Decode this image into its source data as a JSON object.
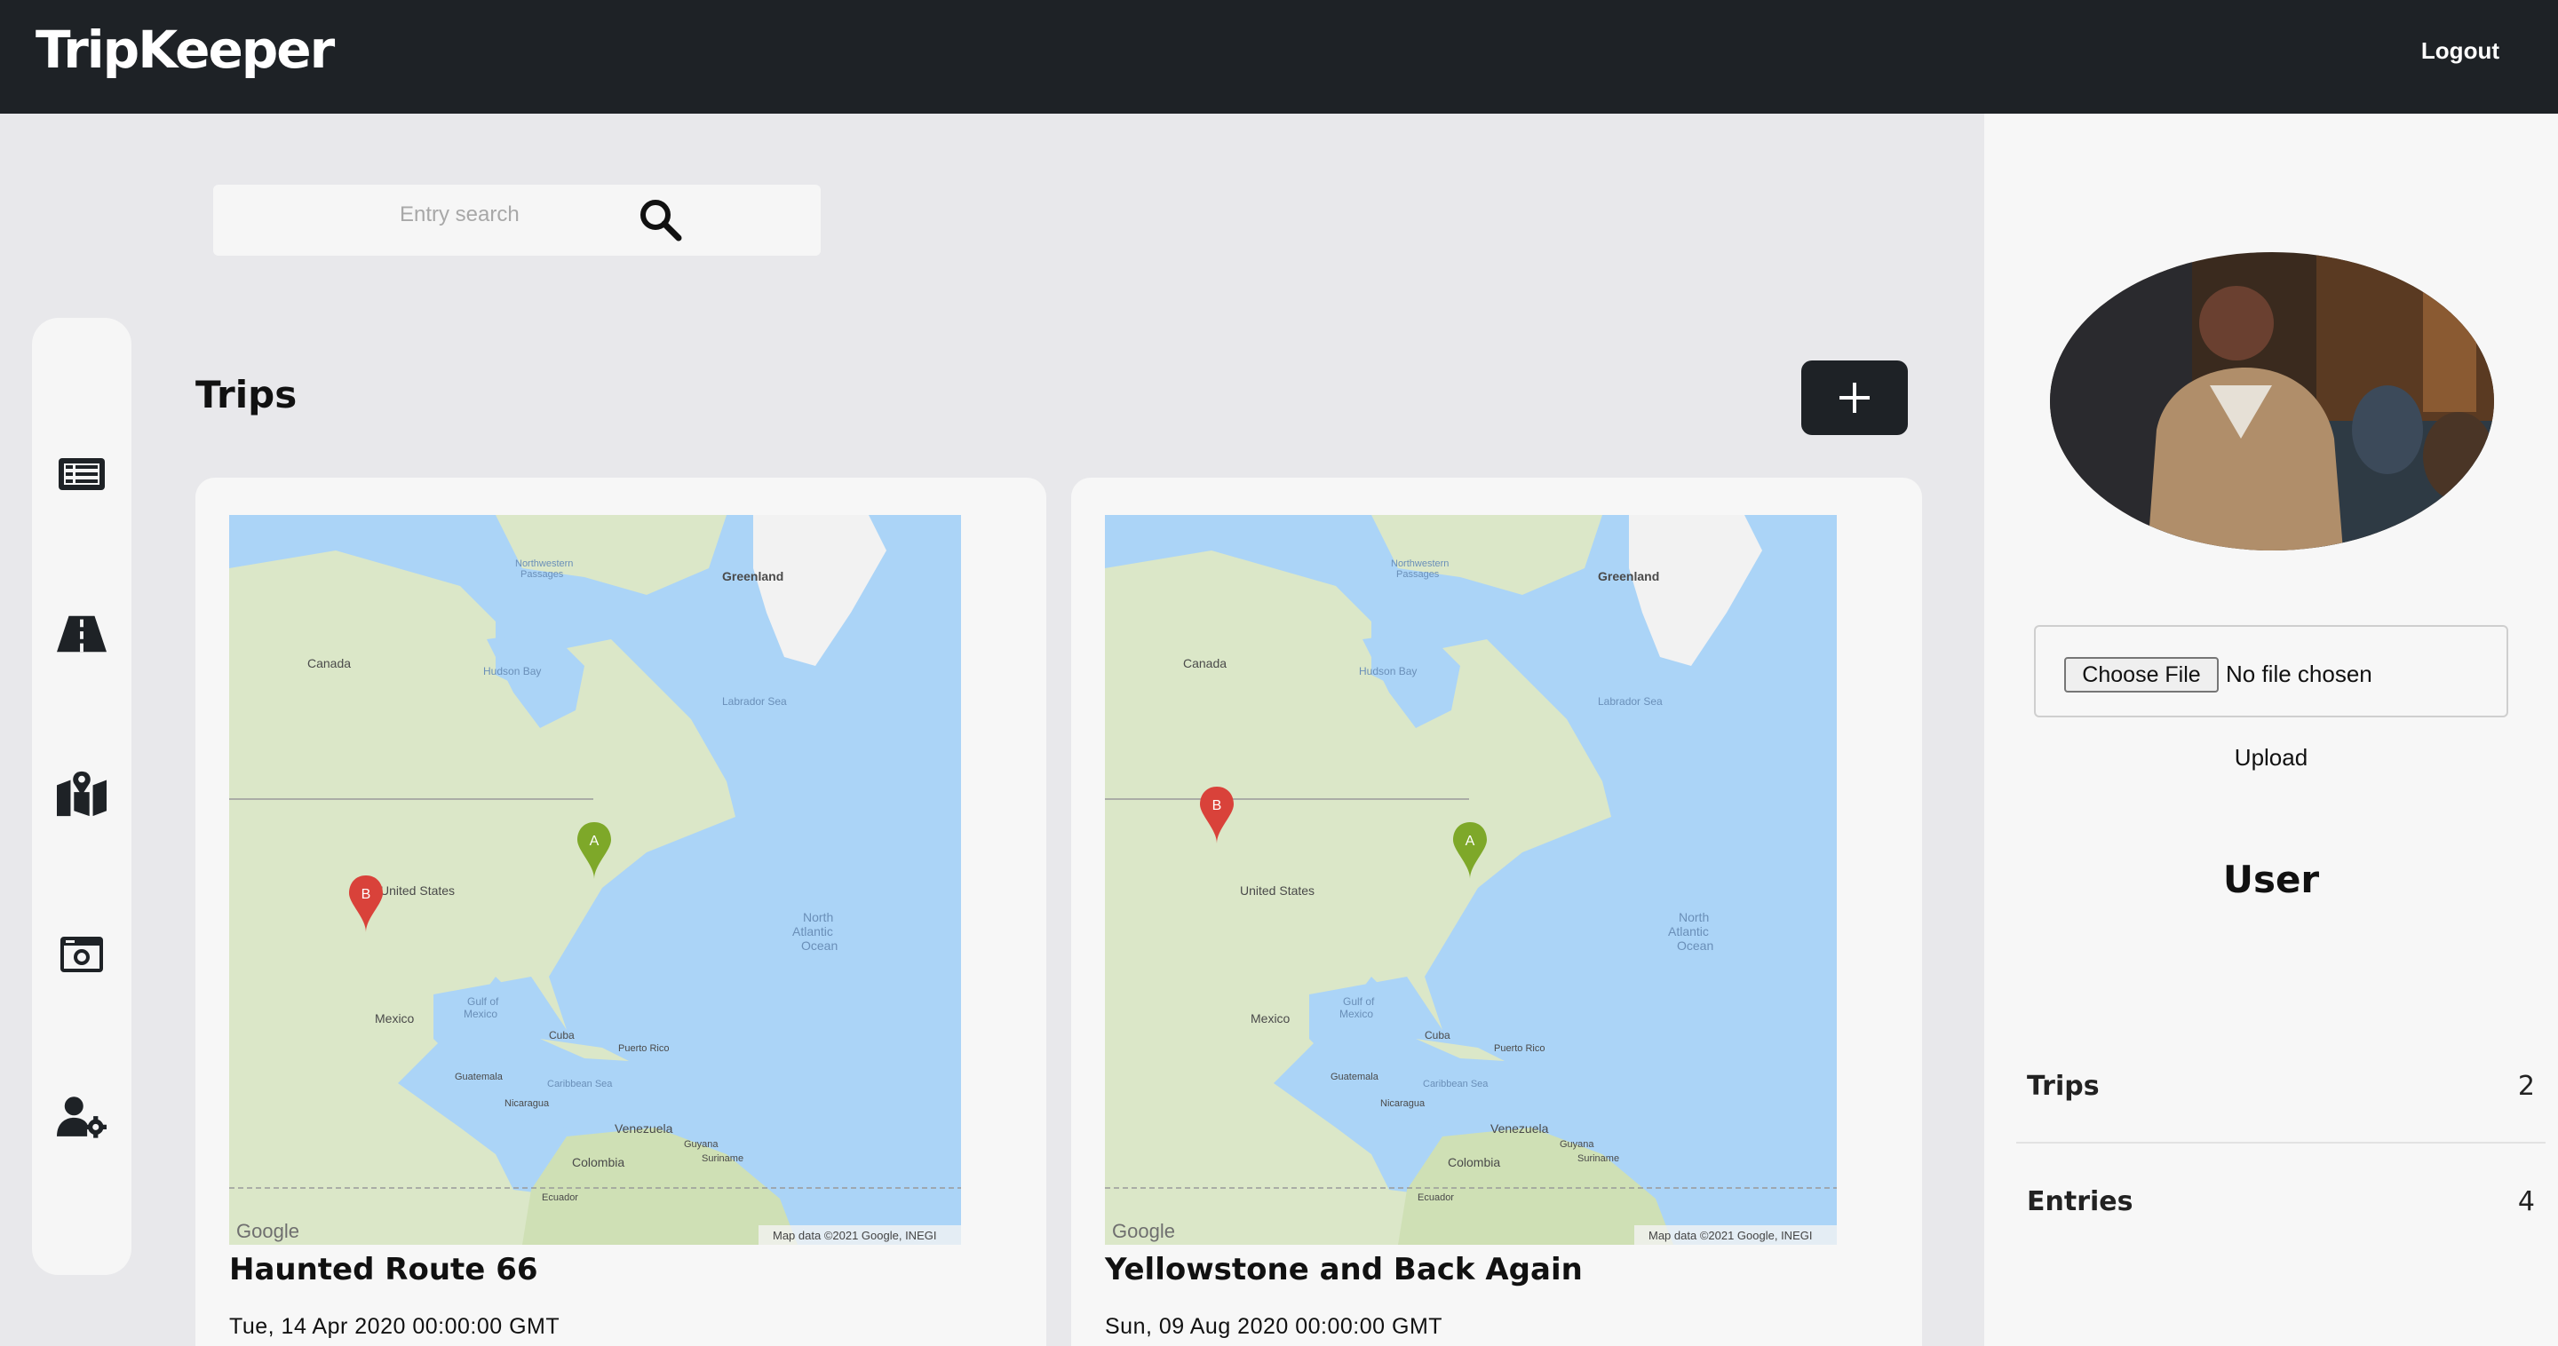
{
  "header": {
    "brand": "TripKeeper",
    "logout_label": "Logout"
  },
  "search": {
    "placeholder": "Entry search"
  },
  "nav": {
    "items": [
      {
        "name": "entries",
        "icon": "list-card-icon"
      },
      {
        "name": "trips",
        "icon": "road-icon"
      },
      {
        "name": "maps",
        "icon": "map-marker-icon"
      },
      {
        "name": "photos",
        "icon": "camera-icon"
      },
      {
        "name": "user-settings",
        "icon": "user-gear-icon"
      }
    ]
  },
  "main": {
    "heading": "Trips",
    "add_icon": "plus-icon",
    "trips": [
      {
        "title": "Haunted Route 66",
        "date": "Tue, 14 Apr 2020 00:00:00 GMT",
        "map": {
          "marker_a": "A",
          "marker_b": "B",
          "labels": {
            "greenland": "Greenland",
            "canada": "Canada",
            "hudson": "Hudson Bay",
            "labrador": "Labrador Sea",
            "nw_passages_1": "Northwestern",
            "nw_passages_2": "Passages",
            "us": "United States",
            "north_atlantic_1": "North",
            "north_atlantic_2": "Atlantic",
            "north_atlantic_3": "Ocean",
            "gulf_1": "Gulf of",
            "gulf_2": "Mexico",
            "mexico": "Mexico",
            "cuba": "Cuba",
            "puerto_rico": "Puerto Rico",
            "guatemala": "Guatemala",
            "nicaragua": "Nicaragua",
            "caribbean": "Caribbean Sea",
            "venezuela": "Venezuela",
            "colombia": "Colombia",
            "guyana": "Guyana",
            "suriname": "Suriname",
            "ecuador": "Ecuador",
            "google": "Google",
            "attribution": "Map data ©2021 Google, INEGI"
          }
        }
      },
      {
        "title": "Yellowstone and Back Again",
        "date": "Sun, 09 Aug 2020 00:00:00 GMT",
        "map": {
          "marker_a": "A",
          "marker_b": "B",
          "labels": {
            "greenland": "Greenland",
            "canada": "Canada",
            "hudson": "Hudson Bay",
            "labrador": "Labrador Sea",
            "nw_passages_1": "Northwestern",
            "nw_passages_2": "Passages",
            "us": "United States",
            "north_atlantic_1": "North",
            "north_atlantic_2": "Atlantic",
            "north_atlantic_3": "Ocean",
            "gulf_1": "Gulf of",
            "gulf_2": "Mexico",
            "mexico": "Mexico",
            "cuba": "Cuba",
            "puerto_rico": "Puerto Rico",
            "guatemala": "Guatemala",
            "nicaragua": "Nicaragua",
            "caribbean": "Caribbean Sea",
            "venezuela": "Venezuela",
            "colombia": "Colombia",
            "guyana": "Guyana",
            "suriname": "Suriname",
            "ecuador": "Ecuador",
            "google": "Google",
            "attribution": "Map data ©2021 Google, INEGI"
          }
        }
      }
    ]
  },
  "profile": {
    "file_input": {
      "button_label": "Choose File",
      "status": "No file chosen"
    },
    "upload_label": "Upload",
    "heading": "User",
    "stats": [
      {
        "label": "Trips",
        "value": "2"
      },
      {
        "label": "Entries",
        "value": "4"
      }
    ]
  },
  "colors": {
    "header_bg": "#1e2226",
    "page_bg": "#e8e8eb",
    "panel_bg": "#f7f7f7",
    "marker_a": "#7ea829",
    "marker_b": "#d9423a",
    "ocean": "#abd4f7",
    "land": "#dbe7c8"
  }
}
